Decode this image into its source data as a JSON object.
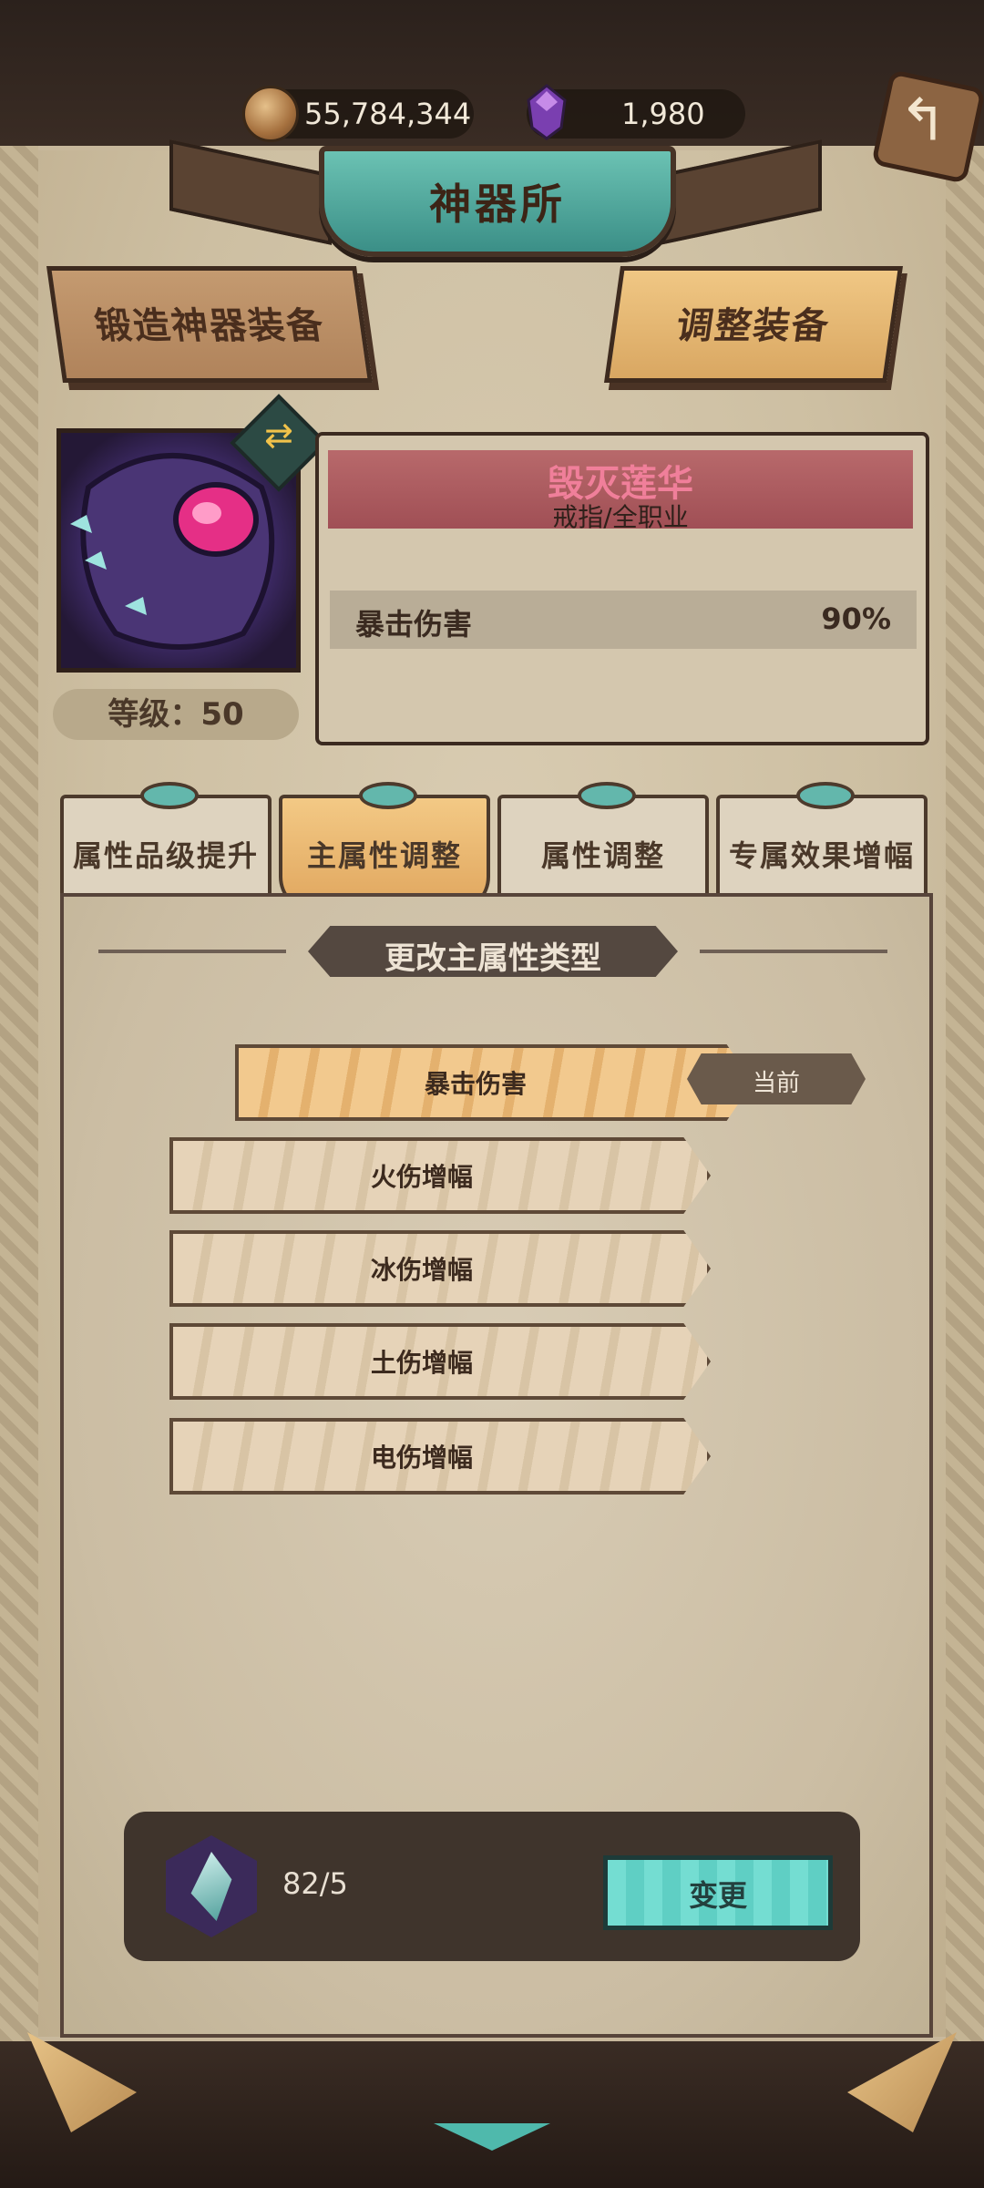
{
  "currencies": {
    "gold": {
      "icon": "coin-icon",
      "value": "55,784,344"
    },
    "gems": {
      "icon": "purple-gem-icon",
      "value": "1,980"
    }
  },
  "header": {
    "title": "神器所",
    "back_icon": "back-arrow-icon"
  },
  "top_buttons": {
    "forge": "锻造神器装备",
    "adjust": "调整装备"
  },
  "item": {
    "name": "毁灭莲华",
    "subtitle": "戒指/全职业",
    "level_label": "等级：50",
    "stat": {
      "label": "暴击伤害",
      "value": "90%"
    },
    "icon": "ring-artifact-icon",
    "swap_icon": "swap-icon"
  },
  "tabs": [
    {
      "label": "属性品级提升",
      "active": false
    },
    {
      "label": "主属性调整",
      "active": true
    },
    {
      "label": "属性调整",
      "active": false
    },
    {
      "label": "专属效果增幅",
      "active": false
    }
  ],
  "section": {
    "title": "更改主属性类型"
  },
  "options": [
    {
      "label": "暴击伤害",
      "selected": true
    },
    {
      "label": "火伤增幅",
      "selected": false
    },
    {
      "label": "冰伤增幅",
      "selected": false
    },
    {
      "label": "土伤增幅",
      "selected": false
    },
    {
      "label": "电伤增幅",
      "selected": false
    }
  ],
  "current_tag": "当前",
  "cost": {
    "icon": "crystal-icon",
    "value": "82/5",
    "button": "变更"
  },
  "colors": {
    "accent_teal": "#5fcfc4",
    "selected_orange": "#e4b16e",
    "name_pink": "#f07f9a"
  }
}
